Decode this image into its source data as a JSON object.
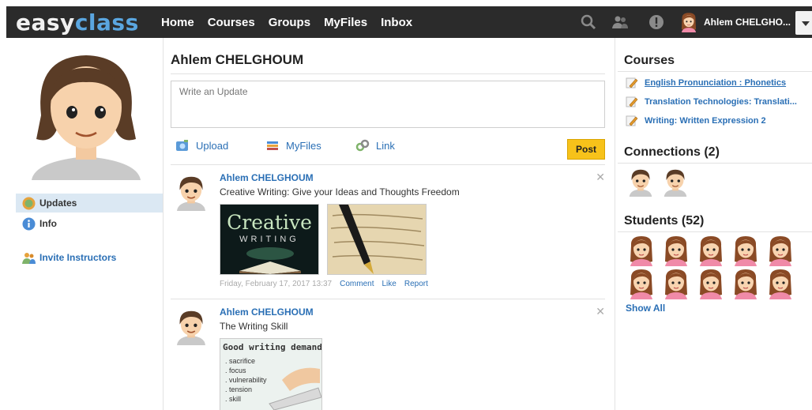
{
  "brand": {
    "part1": "easy",
    "part2": "class"
  },
  "nav": {
    "items": [
      "Home",
      "Courses",
      "Groups",
      "MyFiles",
      "Inbox"
    ]
  },
  "user": {
    "name": "Ahlem CHELGHO..."
  },
  "sidebar": {
    "items": [
      {
        "label": "Updates",
        "icon": "updates-icon"
      },
      {
        "label": "Info",
        "icon": "info-icon"
      },
      {
        "label": "Invite Instructors",
        "icon": "invite-icon"
      }
    ]
  },
  "main": {
    "title": "Ahlem CHELGHOUM",
    "update_placeholder": "Write an Update",
    "actions": {
      "upload": "Upload",
      "myfiles": "MyFiles",
      "link": "Link",
      "post": "Post"
    },
    "posts": [
      {
        "author": "Ahlem CHELGHOUM",
        "text": "Creative Writing: Give your Ideas and Thoughts Freedom",
        "image1_title": "Creative",
        "image1_sub": "WRITING",
        "date": "Friday, February 17, 2017 13:37",
        "comment": "Comment",
        "like": "Like",
        "report": "Report"
      },
      {
        "author": "Ahlem CHELGHOUM",
        "text": "The Writing Skill",
        "image_title": "Good writing demands",
        "image_list": [
          "sacrifice",
          "focus",
          "vulnerability",
          "tension",
          "skill"
        ]
      }
    ]
  },
  "right": {
    "courses_title": "Courses",
    "courses": [
      "English Pronunciation : Phonetics",
      "Translation Technologies: Translati...",
      "Writing: Written Expression 2"
    ],
    "connections_title": "Connections (2)",
    "students_title": "Students (52)",
    "show_all": "Show All"
  },
  "colors": {
    "link": "#2a6fb5",
    "topbar": "#2b2b2b",
    "post_button": "#f7c21a",
    "active_side": "#dbe8f3"
  }
}
